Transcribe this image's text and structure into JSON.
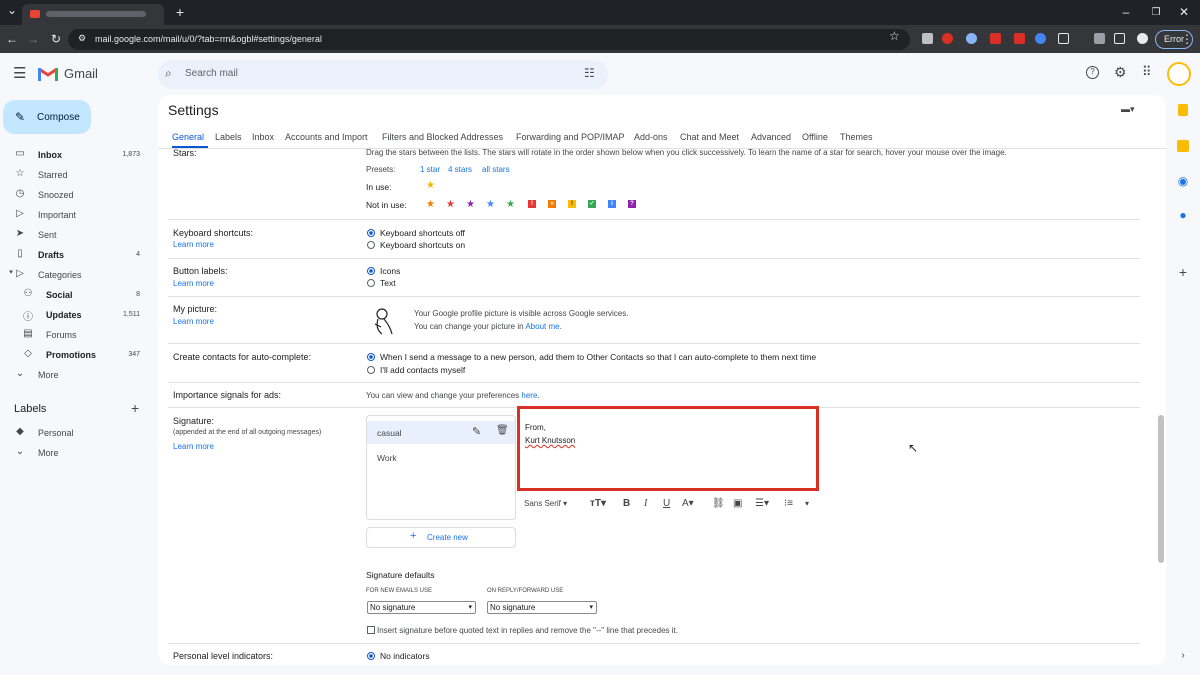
{
  "browser": {
    "url": "mail.google.com/mail/u/0/?tab=rm&ogbl#settings/general",
    "error_label": "Error"
  },
  "header": {
    "app_name": "Gmail",
    "search_placeholder": "Search mail"
  },
  "sidebar": {
    "compose_label": "Compose",
    "items": [
      {
        "label": "Inbox",
        "count": "1,873",
        "icon": "inbox-icon"
      },
      {
        "label": "Starred",
        "count": "",
        "icon": "star-icon"
      },
      {
        "label": "Snoozed",
        "count": "",
        "icon": "clock-icon"
      },
      {
        "label": "Important",
        "count": "",
        "icon": "important-icon"
      },
      {
        "label": "Sent",
        "count": "",
        "icon": "send-icon"
      },
      {
        "label": "Drafts",
        "count": "4",
        "icon": "draft-icon"
      },
      {
        "label": "Categories",
        "count": "",
        "icon": "label-icon"
      },
      {
        "label": "Social",
        "count": "8",
        "icon": "people-icon"
      },
      {
        "label": "Updates",
        "count": "1,511",
        "icon": "info-icon"
      },
      {
        "label": "Forums",
        "count": "",
        "icon": "forum-icon"
      },
      {
        "label": "Promotions",
        "count": "347",
        "icon": "tag-icon"
      },
      {
        "label": "More",
        "count": "",
        "icon": "chevron-down-icon"
      }
    ],
    "labels_heading": "Labels",
    "labels": [
      {
        "label": "Personal"
      },
      {
        "label": "More"
      }
    ]
  },
  "settings": {
    "title": "Settings",
    "tabs": [
      "General",
      "Labels",
      "Inbox",
      "Accounts and Import",
      "Filters and Blocked Addresses",
      "Forwarding and POP/IMAP",
      "Add-ons",
      "Chat and Meet",
      "Advanced",
      "Offline",
      "Themes"
    ],
    "stars": {
      "label": "Stars:",
      "description": "Drag the stars between the lists.  The stars will rotate in the order shown below when you click successively. To learn the name of a star for search, hover your mouse over the image.",
      "presets_label": "Presets:",
      "preset_1": "1 star",
      "preset_4": "4 stars",
      "preset_all": "all stars",
      "in_use_label": "In use:",
      "not_in_use_label": "Not in use:"
    },
    "keyboard": {
      "label": "Keyboard shortcuts:",
      "learn": "Learn more",
      "opt_off": "Keyboard shortcuts off",
      "opt_on": "Keyboard shortcuts on"
    },
    "button_labels": {
      "label": "Button labels:",
      "learn": "Learn more",
      "opt_icons": "Icons",
      "opt_text": "Text"
    },
    "picture": {
      "label": "My picture:",
      "learn": "Learn more",
      "line1": "Your Google profile picture is visible across Google services.",
      "line2_prefix": "You can change your picture in ",
      "line2_link": "About me",
      "line2_suffix": "."
    },
    "contacts": {
      "label": "Create contacts for auto-complete:",
      "opt1": "When I send a message to a new person, add them to Other Contacts so that I can auto-complete to them next time",
      "opt2": "I'll add contacts myself"
    },
    "importance": {
      "label": "Importance signals for ads:",
      "text": "You can view and change your preferences ",
      "link": "here",
      "suffix": "."
    },
    "signature": {
      "label": "Signature:",
      "sublabel": "(appended at the end of all outgoing messages)",
      "learn": "Learn more",
      "items": [
        "casual",
        "Work"
      ],
      "body_line1": "From,",
      "body_line2": "Kurt Knutsson",
      "font": "Sans Serif",
      "create_new": "Create new",
      "defaults_title": "Signature defaults",
      "new_emails_label": "FOR NEW EMAILS USE",
      "reply_label": "ON REPLY/FORWARD USE",
      "new_emails_value": "No signature",
      "reply_value": "No signature",
      "insert_before": "Insert signature before quoted text in replies and remove the \"--\" line that precedes it."
    },
    "personal_level": {
      "label": "Personal level indicators:",
      "opt1": "No indicators"
    }
  }
}
